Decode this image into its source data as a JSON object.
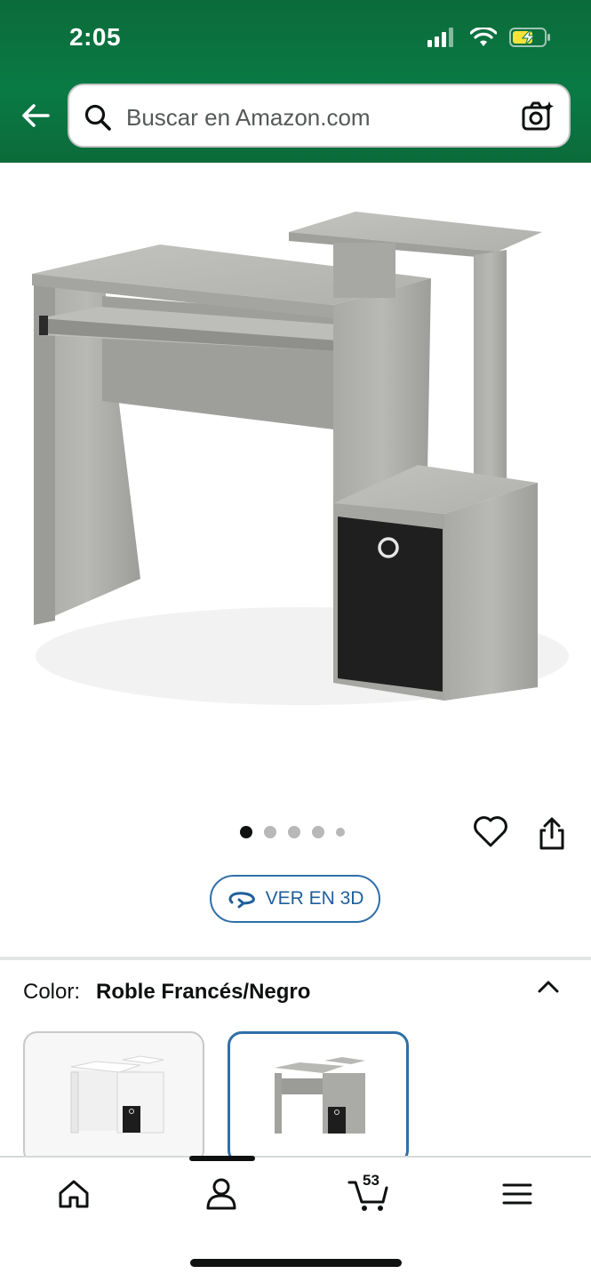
{
  "status_bar": {
    "time": "2:05"
  },
  "search": {
    "placeholder": "Buscar en Amazon.com"
  },
  "gallery": {
    "image_count": 5,
    "active_index": 0
  },
  "view_3d": {
    "label": "VER EN 3D"
  },
  "variation": {
    "label": "Color:",
    "value": "Roble Francés/Negro"
  },
  "swatches": [
    {
      "name": "white-variant",
      "selected": false
    },
    {
      "name": "french-oak-variant",
      "selected": true
    }
  ],
  "tabbar": {
    "cart_count": "53"
  },
  "colors": {
    "header": "#0a7a45",
    "accent": "#2f6fa8"
  }
}
